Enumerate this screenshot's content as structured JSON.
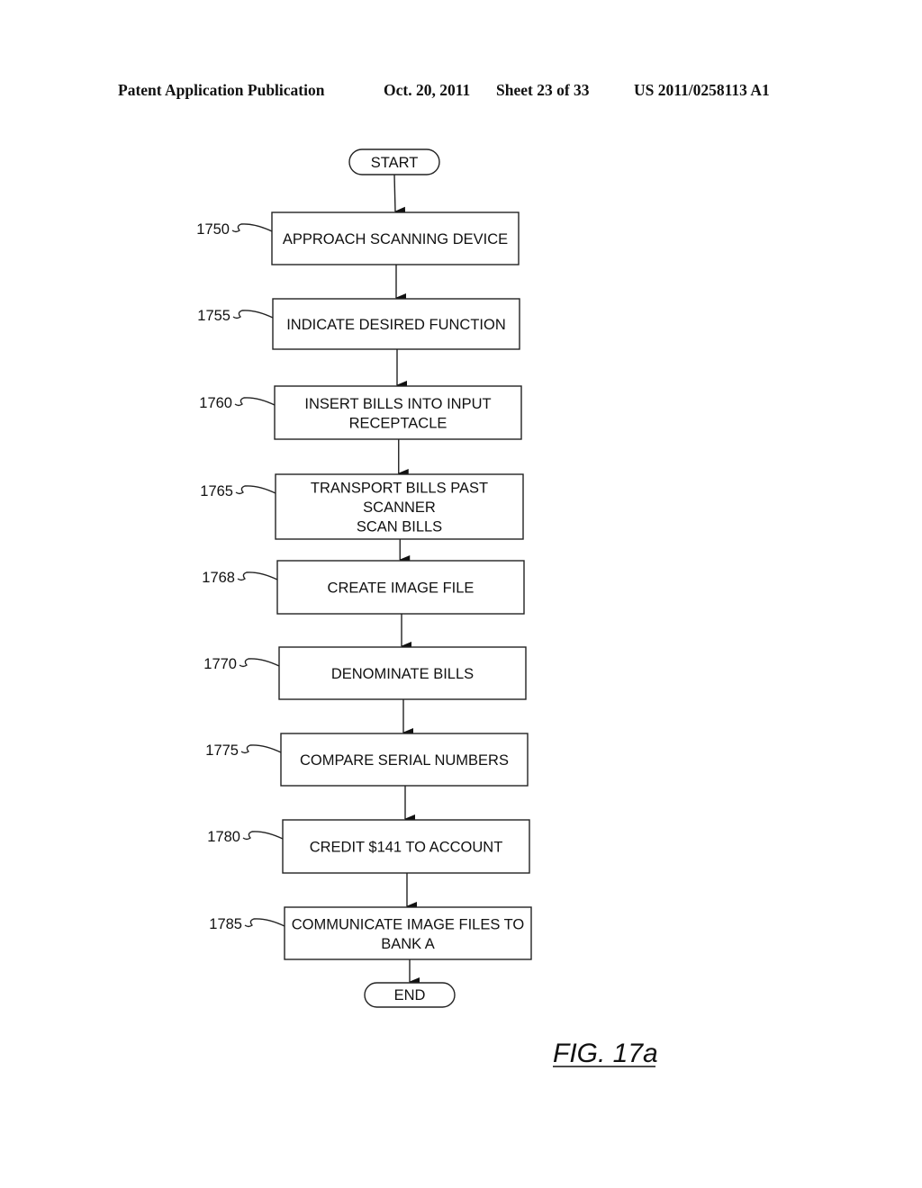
{
  "header": {
    "publication": "Patent Application Publication",
    "date": "Oct. 20, 2011",
    "sheet": "Sheet 23 of 33",
    "number": "US 2011/0258113 A1"
  },
  "flowchart": {
    "start_label": "START",
    "end_label": "END",
    "steps": [
      {
        "ref": "1750",
        "lines": [
          "APPROACH SCANNING DEVICE"
        ]
      },
      {
        "ref": "1755",
        "lines": [
          "INDICATE DESIRED FUNCTION"
        ]
      },
      {
        "ref": "1760",
        "lines": [
          "INSERT BILLS INTO INPUT",
          "RECEPTACLE"
        ]
      },
      {
        "ref": "1765",
        "lines": [
          "TRANSPORT BILLS PAST",
          "SCANNER",
          "SCAN BILLS"
        ]
      },
      {
        "ref": "1768",
        "lines": [
          "CREATE IMAGE FILE"
        ]
      },
      {
        "ref": "1770",
        "lines": [
          "DENOMINATE BILLS"
        ]
      },
      {
        "ref": "1775",
        "lines": [
          "COMPARE SERIAL NUMBERS"
        ]
      },
      {
        "ref": "1780",
        "lines": [
          "CREDIT $141 TO ACCOUNT"
        ]
      },
      {
        "ref": "1785",
        "lines": [
          "COMMUNICATE IMAGE FILES TO",
          "BANK A"
        ]
      }
    ]
  },
  "figure_label": "FIG. 17a"
}
